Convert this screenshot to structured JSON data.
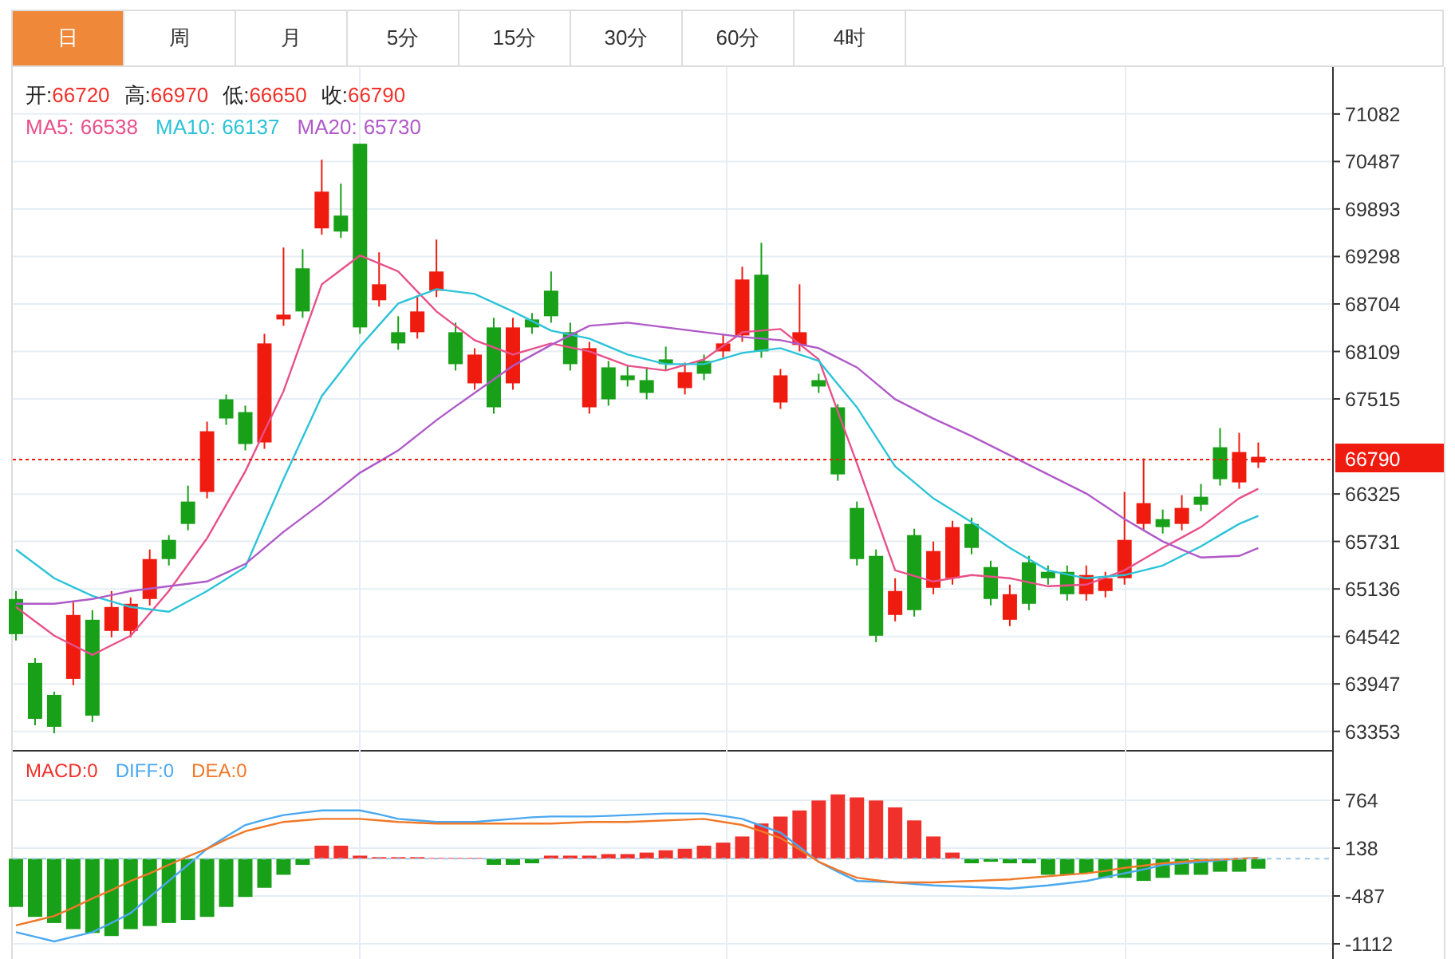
{
  "period_tabs": [
    {
      "label": "日",
      "selected": true
    },
    {
      "label": "周",
      "selected": false
    },
    {
      "label": "月",
      "selected": false
    },
    {
      "label": "5分",
      "selected": false
    },
    {
      "label": "15分",
      "selected": false
    },
    {
      "label": "30分",
      "selected": false
    },
    {
      "label": "60分",
      "selected": false
    },
    {
      "label": "4时",
      "selected": false
    }
  ],
  "price_panel": {
    "quote": [
      {
        "label": "开:",
        "value": "66720"
      },
      {
        "label": "高:",
        "value": "66970"
      },
      {
        "label": "低:",
        "value": "66650"
      },
      {
        "label": "收:",
        "value": "66790"
      }
    ],
    "moving_average_values": [
      "66538",
      "66137",
      "65730"
    ],
    "current_price": "66790",
    "chart_data": {
      "type": "candlestick",
      "grid": true,
      "ylim": [
        63120,
        71670
      ],
      "yticks": [
        71082,
        70487,
        69893,
        69298,
        68704,
        68109,
        67515,
        66325,
        65731,
        65136,
        64542,
        63947,
        63353
      ],
      "ohlc": [
        [
          65010,
          65110,
          64490,
          64570
        ],
        [
          64210,
          64270,
          63430,
          63510
        ],
        [
          63810,
          63850,
          63330,
          63410
        ],
        [
          64010,
          64970,
          63930,
          64810
        ],
        [
          64750,
          64870,
          63470,
          63550
        ],
        [
          64610,
          65110,
          64530,
          64910
        ],
        [
          64610,
          65030,
          64530,
          64950
        ],
        [
          65010,
          65630,
          64930,
          65510
        ],
        [
          65750,
          65810,
          65430,
          65510
        ],
        [
          66230,
          66430,
          65870,
          65950
        ],
        [
          66350,
          67230,
          66270,
          67110
        ],
        [
          67510,
          67570,
          67190,
          67270
        ],
        [
          67350,
          67430,
          66870,
          66950
        ],
        [
          66970,
          68330,
          66890,
          68210
        ],
        [
          68510,
          69410,
          68430,
          68570
        ],
        [
          69150,
          69390,
          68530,
          68610
        ],
        [
          69650,
          70510,
          69570,
          70110
        ],
        [
          69810,
          70210,
          69530,
          69610
        ],
        [
          70710,
          70710,
          68330,
          68410
        ],
        [
          68750,
          69350,
          68670,
          68950
        ],
        [
          68350,
          68550,
          68130,
          68210
        ],
        [
          68350,
          68810,
          68270,
          68610
        ],
        [
          68870,
          69510,
          68790,
          69110
        ],
        [
          68350,
          68470,
          67870,
          67950
        ],
        [
          67710,
          68150,
          67630,
          68070
        ],
        [
          68410,
          68530,
          67330,
          67410
        ],
        [
          67710,
          68530,
          67630,
          68410
        ],
        [
          68510,
          68590,
          68330,
          68410
        ],
        [
          68870,
          69110,
          68470,
          68550
        ],
        [
          68350,
          68470,
          67870,
          67950
        ],
        [
          67410,
          68230,
          67330,
          68150
        ],
        [
          67910,
          67990,
          67430,
          67510
        ],
        [
          67810,
          67930,
          67670,
          67750
        ],
        [
          67750,
          67910,
          67510,
          67590
        ],
        [
          68010,
          68170,
          67870,
          67950
        ],
        [
          67650,
          67970,
          67570,
          67850
        ],
        [
          67990,
          68070,
          67750,
          67830
        ],
        [
          68110,
          68330,
          68030,
          68210
        ],
        [
          68310,
          69170,
          68230,
          69010
        ],
        [
          69070,
          69470,
          68030,
          68110
        ],
        [
          67470,
          67890,
          67390,
          67810
        ],
        [
          68190,
          68950,
          68110,
          68350
        ],
        [
          67750,
          67830,
          67590,
          67670
        ],
        [
          67410,
          67450,
          66490,
          66570
        ],
        [
          66150,
          66230,
          65430,
          65510
        ],
        [
          65550,
          65630,
          64470,
          64550
        ],
        [
          64810,
          65270,
          64730,
          65110
        ],
        [
          65810,
          65890,
          64790,
          64870
        ],
        [
          65150,
          65730,
          65070,
          65610
        ],
        [
          65270,
          65990,
          65190,
          65910
        ],
        [
          65950,
          66030,
          65570,
          65650
        ],
        [
          65410,
          65490,
          64930,
          65010
        ],
        [
          64750,
          65190,
          64670,
          65070
        ],
        [
          65470,
          65550,
          64870,
          64950
        ],
        [
          65350,
          65430,
          65190,
          65270
        ],
        [
          65350,
          65430,
          64990,
          65070
        ],
        [
          65070,
          65430,
          64990,
          65310
        ],
        [
          65110,
          65350,
          65030,
          65270
        ],
        [
          65270,
          66350,
          65190,
          65750
        ],
        [
          65950,
          66770,
          65870,
          66210
        ],
        [
          66010,
          66130,
          65830,
          65910
        ],
        [
          65950,
          66310,
          65870,
          66150
        ],
        [
          66290,
          66450,
          66110,
          66190
        ],
        [
          66910,
          67150,
          66430,
          66510
        ],
        [
          66470,
          67090,
          66390,
          66850
        ],
        [
          66720,
          66970,
          66650,
          66790
        ]
      ],
      "series": [
        {
          "name": "MA5:",
          "type": "line",
          "color": "#e8508a",
          "values": [
            64910,
            64730,
            64550,
            64430,
            64310,
            64430,
            64550,
            64830,
            65110,
            65440,
            65770,
            66190,
            66610,
            67110,
            67610,
            68280,
            68950,
            69130,
            69310,
            69210,
            69110,
            68860,
            68610,
            68430,
            68250,
            68160,
            68070,
            68140,
            68210,
            68160,
            68110,
            68020,
            67930,
            67900,
            67870,
            67940,
            68010,
            68180,
            68350,
            68370,
            68390,
            68200,
            68010,
            67360,
            66710,
            66040,
            65370,
            65300,
            65230,
            65270,
            65310,
            65290,
            65270,
            65220,
            65170,
            65180,
            65190,
            65280,
            65370,
            65510,
            65650,
            65780,
            65910,
            66090,
            66270,
            66390
          ]
        },
        {
          "name": "MA10:",
          "type": "line",
          "color": "#2cc3d8",
          "values": [
            65630,
            65450,
            65270,
            65160,
            65050,
            64980,
            64910,
            64880,
            64850,
            64980,
            65110,
            65260,
            65410,
            65960,
            66510,
            67030,
            67550,
            67860,
            68170,
            68440,
            68710,
            68800,
            68890,
            68860,
            68830,
            68720,
            68610,
            68490,
            68370,
            68320,
            68270,
            68170,
            68070,
            68010,
            67950,
            67950,
            67950,
            68020,
            68090,
            68120,
            68150,
            68070,
            67990,
            67700,
            67410,
            67040,
            66670,
            66470,
            66270,
            66120,
            65970,
            65810,
            65650,
            65510,
            65370,
            65320,
            65270,
            65290,
            65310,
            65370,
            65430,
            65550,
            65670,
            65810,
            65950,
            66050
          ]
        },
        {
          "name": "MA20:",
          "type": "line",
          "color": "#b05ac8",
          "values": [
            64950,
            64950,
            64950,
            64980,
            65010,
            65060,
            65110,
            65140,
            65170,
            65200,
            65230,
            65340,
            65450,
            65650,
            65850,
            66030,
            66210,
            66400,
            66590,
            66730,
            66870,
            67060,
            67250,
            67420,
            67590,
            67760,
            67930,
            68060,
            68190,
            68310,
            68430,
            68450,
            68470,
            68440,
            68410,
            68380,
            68350,
            68320,
            68290,
            68270,
            68250,
            68200,
            68150,
            68030,
            67910,
            67710,
            67510,
            67390,
            67270,
            67160,
            67050,
            66930,
            66810,
            66690,
            66570,
            66450,
            66330,
            66170,
            66010,
            65870,
            65730,
            65630,
            65530,
            65540,
            65550,
            65650
          ]
        }
      ]
    }
  },
  "macd_panel": {
    "line_values": [
      "0",
      "0",
      "0"
    ],
    "chart_data": {
      "type": "line",
      "grid": true,
      "ylim": [
        -1310,
        1420
      ],
      "yticks": [
        764,
        138,
        -487,
        -1112
      ],
      "series": [
        {
          "name": "MACD:",
          "type": "bar",
          "colors": [
            "#18a018",
            "#18a018",
            "#18a018",
            "#18a018",
            "#18a018",
            "#18a018",
            "#18a018",
            "#18a018",
            "#18a018",
            "#18a018",
            "#18a018",
            "#18a018",
            "#18a018",
            "#18a018",
            "#18a018",
            "#18a018",
            "#f0302a",
            "#f0302a",
            "#f0302a",
            "#f0302a",
            "#f0302a",
            "#f0302a",
            "#f0302a",
            "#f0302a",
            "#f0302a",
            "#18a018",
            "#18a018",
            "#18a018",
            "#f0302a",
            "#f0302a",
            "#f0302a",
            "#f0302a",
            "#f0302a",
            "#f0302a",
            "#f0302a",
            "#f0302a",
            "#f0302a",
            "#f0302a",
            "#f0302a",
            "#f0302a",
            "#f0302a",
            "#f0302a",
            "#f0302a",
            "#f0302a",
            "#f0302a",
            "#f0302a",
            "#f0302a",
            "#f0302a",
            "#f0302a",
            "#f0302a",
            "#18a018",
            "#18a018",
            "#18a018",
            "#18a018",
            "#18a018",
            "#18a018",
            "#18a018",
            "#18a018",
            "#18a018",
            "#18a018",
            "#18a018",
            "#18a018",
            "#18a018",
            "#18a018",
            "#18a018",
            "#18a018"
          ],
          "values": [
            -630,
            -760,
            -840,
            -920,
            -970,
            -1010,
            -920,
            -880,
            -840,
            -800,
            -760,
            -630,
            -500,
            -380,
            -210,
            -80,
            170,
            170,
            40,
            20,
            20,
            20,
            10,
            10,
            10,
            -80,
            -80,
            -60,
            40,
            40,
            40,
            60,
            60,
            80,
            110,
            130,
            170,
            210,
            290,
            460,
            550,
            630,
            760,
            840,
            800,
            760,
            670,
            500,
            290,
            80,
            -60,
            -40,
            -60,
            -60,
            -210,
            -210,
            -190,
            -250,
            -250,
            -290,
            -250,
            -210,
            -210,
            -170,
            -170,
            -130
          ]
        },
        {
          "name": "DIFF:",
          "color": "#4aa8f0",
          "values": [
            -960,
            -1020,
            -1080,
            -1020,
            -960,
            -840,
            -710,
            -500,
            -290,
            -80,
            130,
            290,
            440,
            510,
            570,
            600,
            630,
            630,
            630,
            580,
            520,
            500,
            480,
            480,
            480,
            500,
            520,
            540,
            550,
            550,
            550,
            560,
            570,
            580,
            590,
            590,
            590,
            560,
            520,
            430,
            340,
            150,
            -40,
            -170,
            -290,
            -300,
            -310,
            -330,
            -350,
            -360,
            -370,
            -380,
            -390,
            -370,
            -350,
            -320,
            -290,
            -240,
            -190,
            -140,
            -80,
            -60,
            -40,
            -20,
            0,
            10
          ]
        },
        {
          "name": "DEA:",
          "color": "#f07828",
          "values": [
            -870,
            -810,
            -750,
            -640,
            -520,
            -410,
            -290,
            -190,
            -80,
            30,
            130,
            250,
            360,
            420,
            480,
            500,
            520,
            520,
            520,
            500,
            480,
            470,
            460,
            460,
            460,
            460,
            460,
            460,
            460,
            470,
            480,
            480,
            480,
            490,
            500,
            510,
            520,
            480,
            440,
            360,
            270,
            120,
            -40,
            -150,
            -250,
            -280,
            -310,
            -310,
            -310,
            -300,
            -290,
            -280,
            -270,
            -250,
            -230,
            -210,
            -190,
            -160,
            -120,
            -90,
            -60,
            -40,
            -20,
            -10,
            0,
            10
          ]
        }
      ]
    }
  }
}
